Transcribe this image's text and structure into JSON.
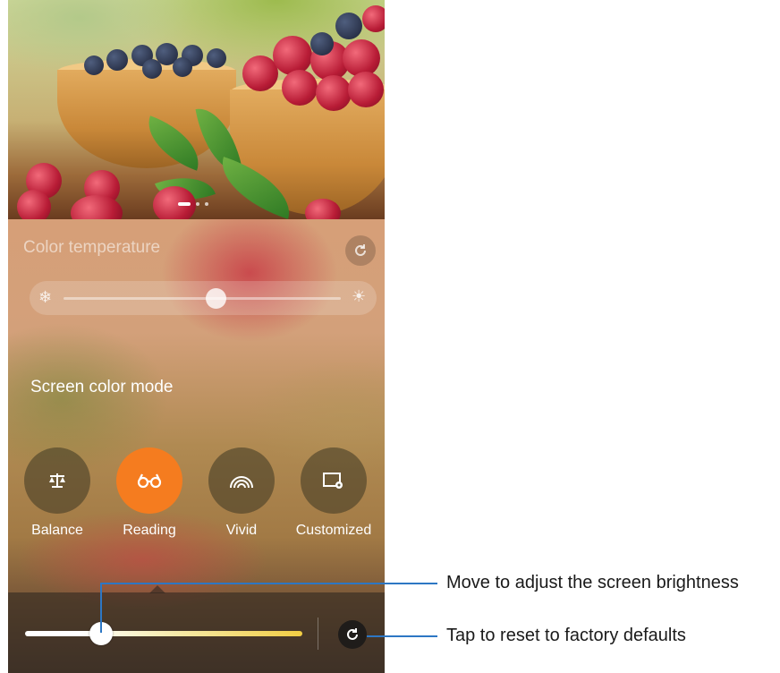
{
  "color_temperature": {
    "title": "Color temperature",
    "cool_icon": "snowflake-icon",
    "warm_icon": "sun-icon",
    "reset_icon": "reset-icon",
    "level": 0.55
  },
  "screen_color_mode": {
    "title": "Screen color mode",
    "modes": [
      {
        "label": "Balance",
        "icon": "balance-scale-icon",
        "selected": false
      },
      {
        "label": "Reading",
        "icon": "glasses-icon",
        "selected": true
      },
      {
        "label": "Vivid",
        "icon": "vivid-arc-icon",
        "selected": false
      },
      {
        "label": "Customized",
        "icon": "customize-settings-icon",
        "selected": false
      }
    ]
  },
  "brightness": {
    "level": 0.25,
    "reset_icon": "reset-icon"
  },
  "callouts": {
    "brightness": "Move to adjust the screen brightness",
    "reset": "Tap to reset to factory defaults"
  },
  "colors": {
    "accent_selected": "#f57c1f",
    "callout_line": "#2d77c4"
  }
}
